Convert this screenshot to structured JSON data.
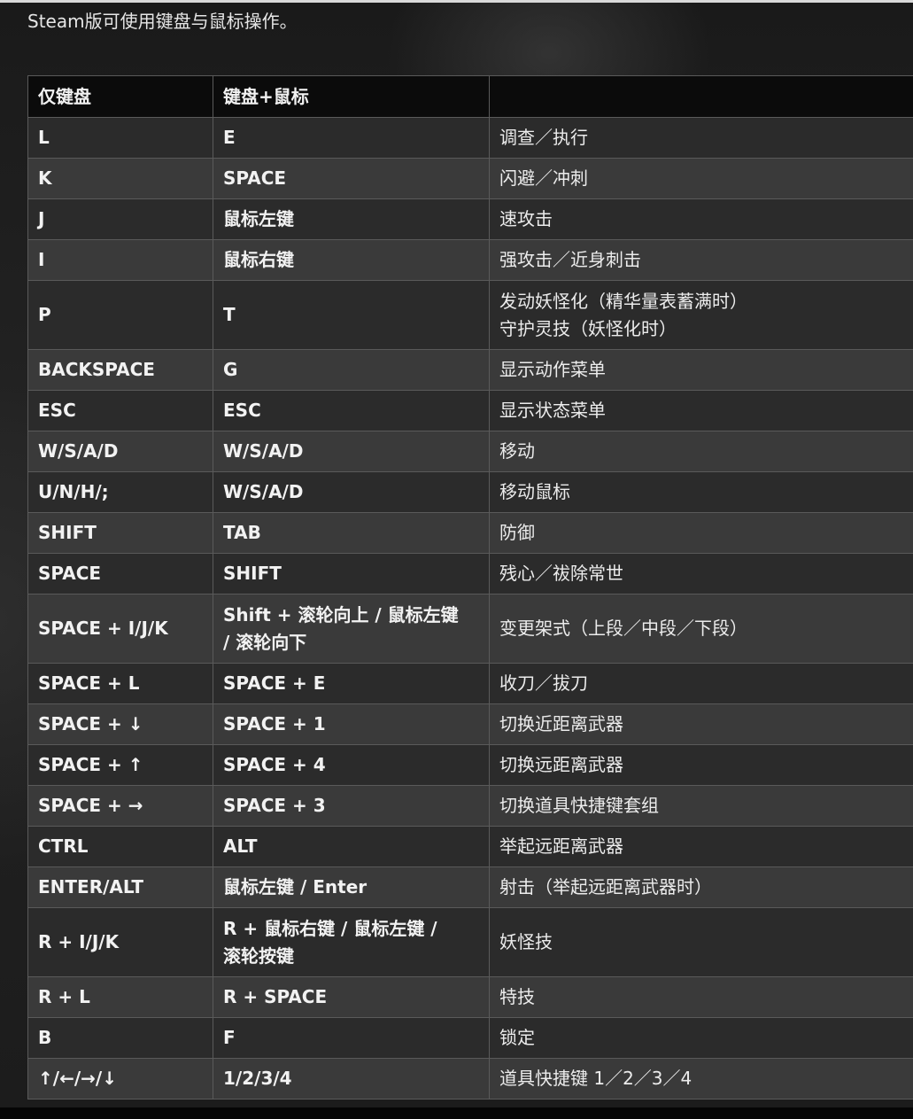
{
  "intro": "Steam版可使用键盘与鼠标操作。",
  "headers": [
    "仅键盘",
    "键盘+鼠标",
    ""
  ],
  "rows": [
    {
      "kb": "L",
      "km": "E",
      "act": "调查／执行"
    },
    {
      "kb": "K",
      "km": "SPACE",
      "act": "闪避／冲刺"
    },
    {
      "kb": "J",
      "km": "鼠标左键",
      "act": "速攻击"
    },
    {
      "kb": "I",
      "km": "鼠标右键",
      "act": "强攻击／近身刺击"
    },
    {
      "kb": "P",
      "km": "T",
      "act": "发动妖怪化（精华量表蓄满时）\n守护灵技（妖怪化时）"
    },
    {
      "kb": "BACKSPACE",
      "km": "G",
      "act": "显示动作菜单"
    },
    {
      "kb": "ESC",
      "km": "ESC",
      "act": "显示状态菜单"
    },
    {
      "kb": "W/S/A/D",
      "km": "W/S/A/D",
      "act": "移动"
    },
    {
      "kb": "U/N/H/;",
      "km": "W/S/A/D",
      "act": "移动鼠标"
    },
    {
      "kb": "SHIFT",
      "km": "TAB",
      "act": "防御"
    },
    {
      "kb": "SPACE",
      "km": "SHIFT",
      "act": "残心／祓除常世"
    },
    {
      "kb": "SPACE + I/J/K",
      "km": "Shift + 滚轮向上 / 鼠标左键\n/ 滚轮向下",
      "act": "变更架式（上段／中段／下段）"
    },
    {
      "kb": "SPACE + L",
      "km": "SPACE + E",
      "act": "收刀／拔刀"
    },
    {
      "kb": "SPACE + ↓",
      "km": "SPACE + 1",
      "act": "切换近距离武器"
    },
    {
      "kb": "SPACE + ↑",
      "km": "SPACE + 4",
      "act": "切换远距离武器"
    },
    {
      "kb": "SPACE + →",
      "km": "SPACE + 3",
      "act": "切换道具快捷键套组"
    },
    {
      "kb": "CTRL",
      "km": "ALT",
      "act": "举起远距离武器"
    },
    {
      "kb": "ENTER/ALT",
      "km": "鼠标左键 / Enter",
      "act": "射击（举起远距离武器时）"
    },
    {
      "kb": "R + I/J/K",
      "km": "R + 鼠标右键 / 鼠标左键 /\n滚轮按键",
      "act": "妖怪技"
    },
    {
      "kb": "R + L",
      "km": "R + SPACE",
      "act": "特技"
    },
    {
      "kb": "B",
      "km": "F",
      "act": "锁定"
    },
    {
      "kb": "↑/←/→/↓",
      "km": "1/2/3/4",
      "act": "道具快捷键 1／2／3／4"
    }
  ]
}
